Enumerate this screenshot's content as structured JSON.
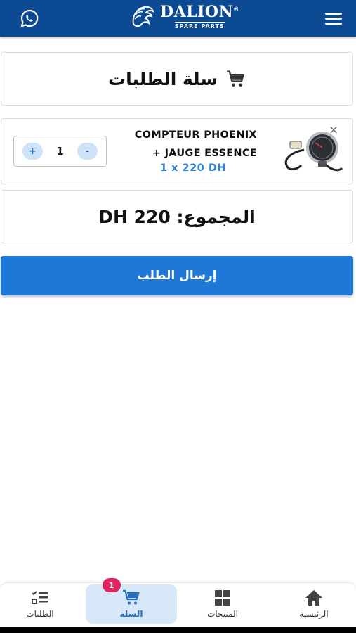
{
  "header": {
    "brand_name": "DALION",
    "brand_reg": "®",
    "brand_tagline": "SPARE PARTS",
    "color": "#0c4a94"
  },
  "cart": {
    "title": "سلة الطلبات"
  },
  "item": {
    "name_line1": "COMPTEUR PHOENIX",
    "name_line2": "+ JAUGE ESSENCE",
    "price_line": "1 x 220 DH",
    "quantity": "1",
    "increase_label": "+",
    "decrease_label": "-",
    "close_label": "×"
  },
  "total": {
    "text": "المجموع: 220 DH"
  },
  "submit": {
    "label": "إرسال الطلب"
  },
  "nav": {
    "orders": "الطلبات",
    "cart": "السلة",
    "cart_badge": "1",
    "products": "المنتجات",
    "home": "الرئيسية"
  },
  "colors": {
    "accent": "#1f78d6",
    "badge": "#e0245e"
  }
}
